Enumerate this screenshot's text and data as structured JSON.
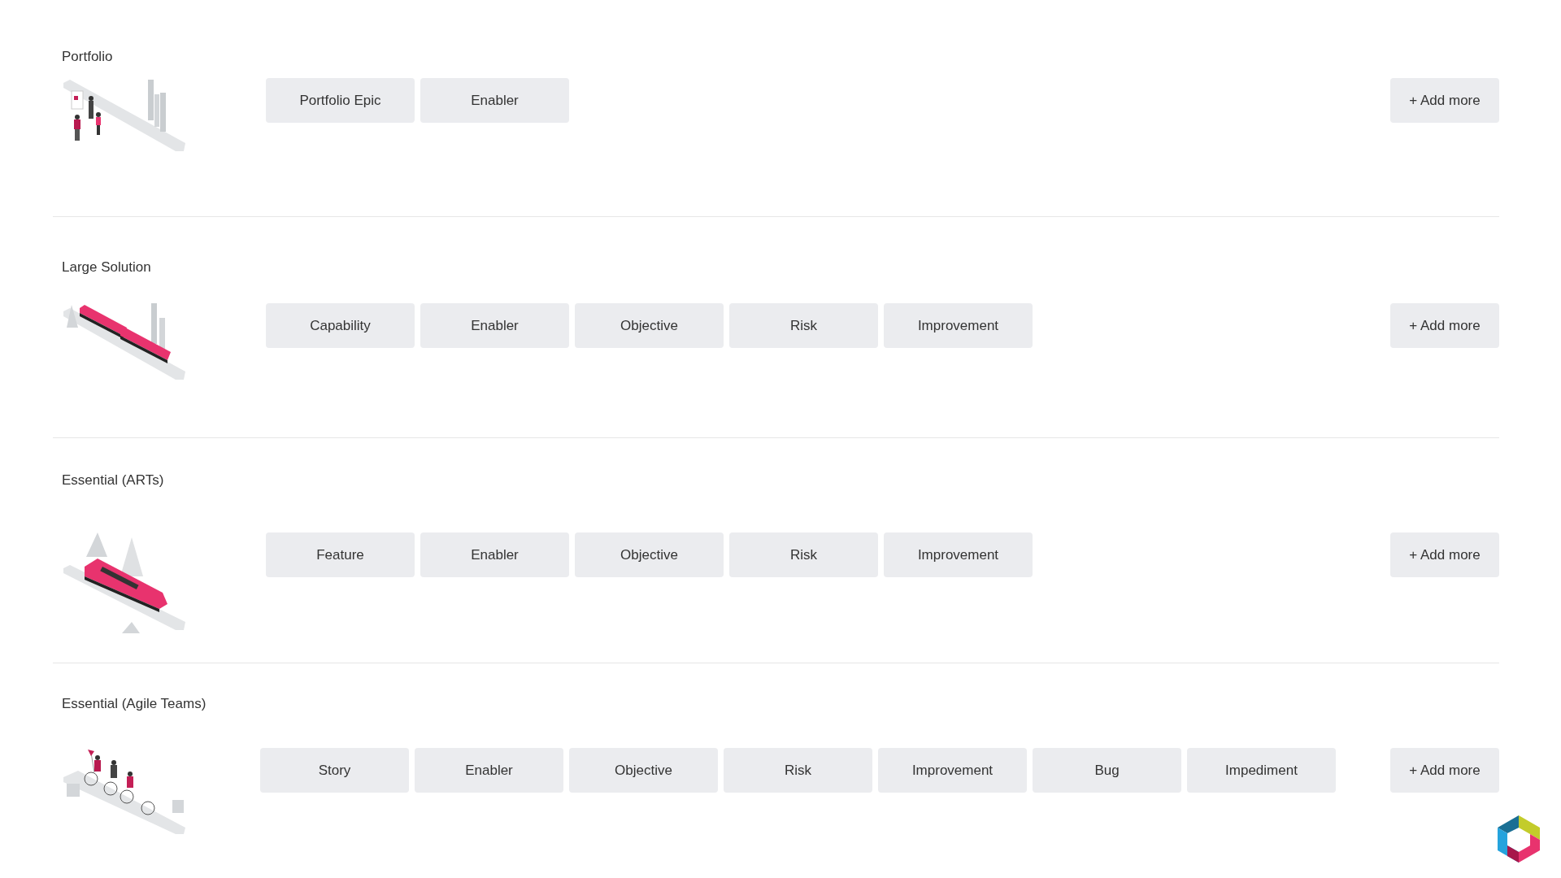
{
  "sections": [
    {
      "title": "Portfolio",
      "items": [
        "Portfolio Epic",
        "Enabler"
      ],
      "add_button": "+ Add more"
    },
    {
      "title": "Large Solution",
      "items": [
        "Capability",
        "Enabler",
        "Objective",
        "Risk",
        "Improvement"
      ],
      "add_button": "+ Add more"
    },
    {
      "title": "Essential (ARTs)",
      "items": [
        "Feature",
        "Enabler",
        "Objective",
        "Risk",
        "Improvement"
      ],
      "add_button": "+ Add more"
    },
    {
      "title": "Essential (Agile Teams)",
      "items": [
        "Story",
        "Enabler",
        "Objective",
        "Risk",
        "Improvement",
        "Bug",
        "Impediment"
      ],
      "add_button": "+ Add more"
    }
  ]
}
